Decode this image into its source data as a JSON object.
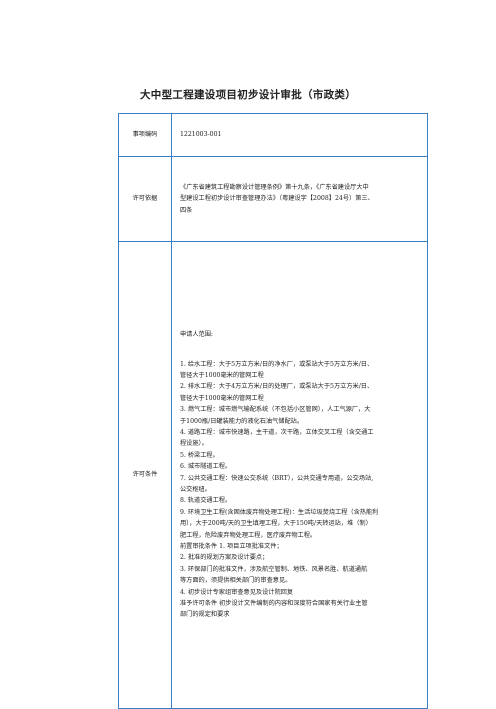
{
  "title": "大中型工程建设项目初步设计审批（市政类）",
  "rows": [
    {
      "label": "事项编码",
      "lines": [
        "1221003-001"
      ]
    },
    {
      "label": "许可依据",
      "lines": [
        "《广东省建筑工程勘察设计管理条例》第十九条，《广东省建设厅大中",
        "型建设工程初步设计审查管理办法》（粤建设字【2008】24号）第三、",
        "四条"
      ]
    },
    {
      "label": "许可条件",
      "lines": [
        "申请人范围:",
        "1. 给水工程：大于5万立方米/日的净水厂，或泵站大于5万立方米/日、",
        "管径大于1000毫米的管网工程",
        "2. 排水工程：大于4万立方米/日的处理厂，或泵站大于5万立方米/日、",
        "管径大于1000毫米的管网工程",
        "3. 燃气工程：城市燃气输配系统（不包括小区管网），人工气源厂，大",
        "于1000瓶/日罐装能力的液化石油气储配站。",
        "4. 道路工程：城市快速路，主干道，次干路，立体交叉工程（含交通工",
        "程设施）。",
        "5. 桥梁工程。",
        "6. 城市隧道工程。",
        "7. 公共交通工程：快速公交系统（BRT），公共交通专用道，公交场站,",
        "公交枢纽。",
        "8. 轨道交通工程。",
        "9. 环境卫生工程(含固体废弃物处理工程)：生活垃圾焚烧工程（含热能利",
        "用），大于200吨/天的卫生填埋工程，大于150吨/天转运站，堆（制）",
        "肥工程，危险废弃物处理工程，医疗废弃物工程。",
        " 前置审批条件 1. 项目立项批准文件；",
        "2. 批准的规划方案及设计要点；",
        "3. 环保部门的批准文件，涉及航空管制、地铁、风景名胜、航道通航",
        "等方面的，须提供相关部门的审查意见。",
        "4. 初步设计专家组审查意见及设计院回复",
        "准予许可条件 初步设计文件编制的内容和深度符合国家有关行业主管",
        "部门的规定和要求"
      ]
    }
  ]
}
